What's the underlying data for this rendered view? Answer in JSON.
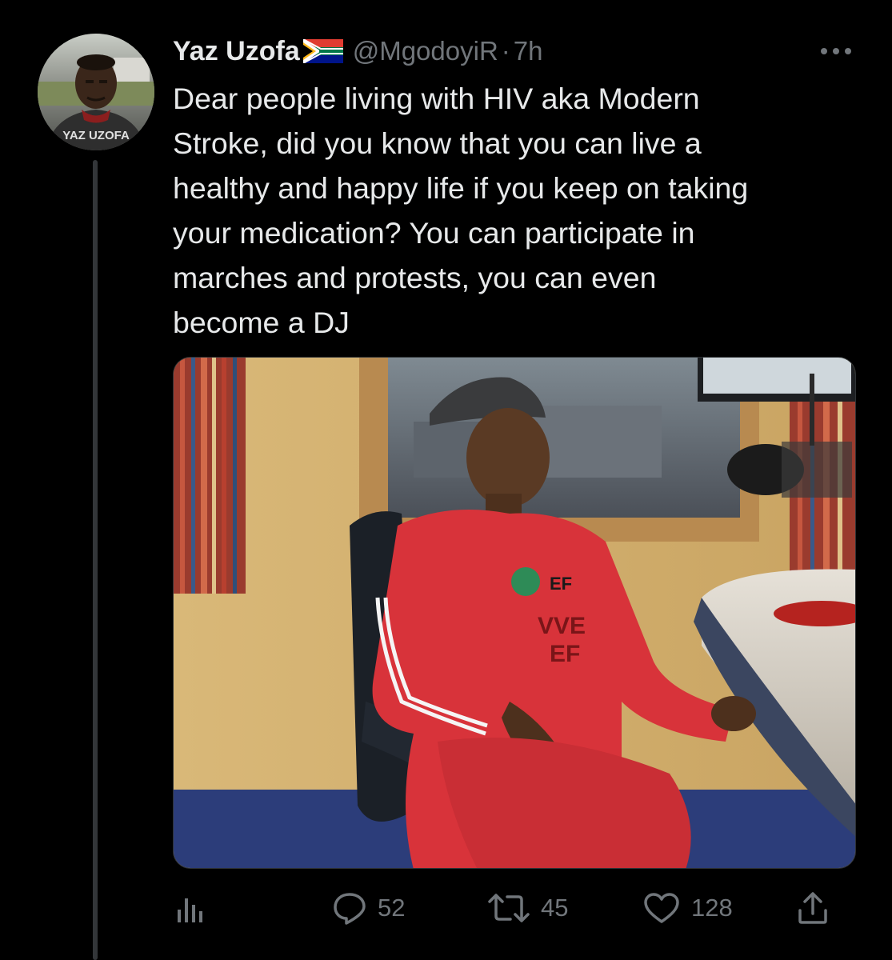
{
  "tweet": {
    "display_name": "Yaz Uzofa",
    "flag_icon": "south-africa-flag-icon",
    "handle": "@MgodoyiR",
    "separator": "·",
    "time": "7h",
    "more_icon": "more-horizontal-icon",
    "avatar_caption": "YAZ UZOFA",
    "text_lines": [
      "Dear people living with HIV aka Modern",
      "Stroke, did you know that you can live a",
      "healthy and happy life if you keep on taking",
      "your medication? You can participate in",
      "marches and protests, you can even",
      "become a DJ"
    ],
    "media": {
      "description_icon": "photo"
    }
  },
  "actions": {
    "analytics": {
      "icon": "analytics-icon"
    },
    "reply": {
      "icon": "reply-icon",
      "count": "52"
    },
    "retweet": {
      "icon": "retweet-icon",
      "count": "45"
    },
    "like": {
      "icon": "heart-icon",
      "count": "128"
    },
    "share": {
      "icon": "share-icon"
    }
  },
  "colors": {
    "background": "#000000",
    "text": "#e7e9ea",
    "secondary": "#71767b",
    "thread_line": "#333639"
  }
}
